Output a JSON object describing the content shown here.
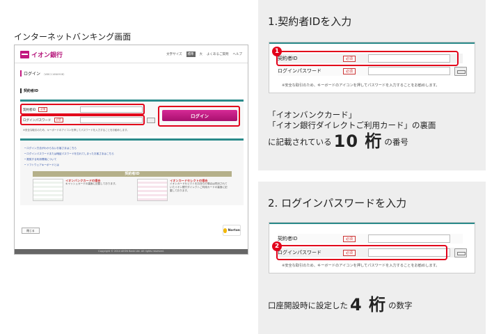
{
  "left": {
    "title": "インターネットバンキング画面",
    "mock": {
      "logo": "イオン銀行",
      "nav": [
        "文字サイズ",
        "標準",
        "大",
        "よくあるご質問",
        "ヘルプ"
      ],
      "login_heading": "ログイン",
      "login_sub": "（WBC116N090B）",
      "section_label": "契約者ID",
      "field1_label": "契約者ID",
      "field2_label": "ログインパスワード",
      "required": "必須",
      "login_button": "ログイン",
      "note": "※安全な取引のため、キーボードのアイコンを押してパスワードを入力することをお勧めします。",
      "links": [
        "ログイン方法がわからないお客さまはこちら",
        "ログインパスワードまたは暗証パスワードを忘れてしまったお客さまはこちら",
        "推奨する利用環境について",
        "ソフトウェアキーボードとは"
      ],
      "id_bar": "契約者ID",
      "card1_title": "イオンバンクカードの場合",
      "card1_text": "キャッシュカードの裏面に記載しております。",
      "card2_title": "イオンカードセレクトの場合",
      "card2_text": "イオンカードセレクトをお持ちの場合は同封されていたイオン銀行ダイレクトご利用カードの裏面に記載しております。",
      "close_button": "閉じる",
      "norton": "Norton",
      "footer": "Copyright © 2014 AEON Bank Ltd. All rights reserved."
    }
  },
  "step1": {
    "title": "1.契約者IDを入力",
    "field1_label": "契約者ID",
    "field2_label": "ログインパスワード",
    "required": "必須",
    "badge": "1",
    "note": "※安全な取引のため、キーボードのアイコンを押してパスワードを入力することをお勧めします。",
    "desc_line1": "「イオンバンクカード」",
    "desc_line2": "「イオン銀行ダイレクトご利用カード」の裏面",
    "desc_line3_pre": "に記載されている",
    "desc_big": "10 桁",
    "desc_line3_post": "の番号"
  },
  "step2": {
    "title": "2. ログインパスワードを入力",
    "field1_label": "契約者ID",
    "field2_label": "ログインパスワード",
    "required": "必須",
    "badge": "2",
    "note": "※安全な取引のため、キーボードのアイコンを押してパスワードを入力することをお勧めします。",
    "desc_pre": "口座開設時に設定した",
    "desc_big": "4 桁",
    "desc_post": "の数字"
  },
  "colors": {
    "highlight": "#e2001a",
    "brand": "#c2187f",
    "panel": "#eeeeee"
  }
}
